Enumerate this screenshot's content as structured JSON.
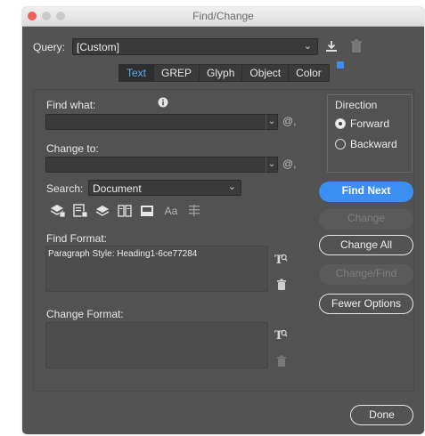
{
  "window": {
    "title": "Find/Change",
    "traffic_lights": {
      "close": "#ee5f57",
      "min": "#c9c9c9",
      "max": "#c9c9c9"
    }
  },
  "query": {
    "label": "Query:",
    "value": "[Custom]",
    "save_icon": "save-query-icon",
    "delete_icon": "trash-icon"
  },
  "tabs": [
    {
      "label": "Text",
      "active": true
    },
    {
      "label": "GREP",
      "active": false
    },
    {
      "label": "Glyph",
      "active": false
    },
    {
      "label": "Object",
      "active": false
    },
    {
      "label": "Color",
      "active": false
    }
  ],
  "find_what": {
    "label": "Find what:",
    "value": "",
    "info_icon": "info-icon",
    "special_icon": "at-symbol-icon"
  },
  "change_to": {
    "label": "Change to:",
    "value": "",
    "special_icon": "at-symbol-icon"
  },
  "search": {
    "label": "Search:",
    "value": "Document"
  },
  "direction": {
    "label": "Direction",
    "options": [
      {
        "label": "Forward",
        "selected": true
      },
      {
        "label": "Backward",
        "selected": false
      }
    ]
  },
  "buttons": {
    "find_next": "Find Next",
    "change": "Change",
    "change_all": "Change All",
    "change_find": "Change/Find",
    "fewer_options": "Fewer Options",
    "done": "Done"
  },
  "find_format": {
    "label": "Find Format:",
    "value": "Paragraph Style: Heading1-6ce77284"
  },
  "change_format": {
    "label": "Change Format:",
    "value": ""
  },
  "option_icons": {
    "aa_label": "Aa"
  },
  "colors": {
    "panel_bg": "#535353",
    "field_bg": "#3a3a3a",
    "accent": "#3b8ff3",
    "active_tab_text": "#5aa9f2"
  }
}
